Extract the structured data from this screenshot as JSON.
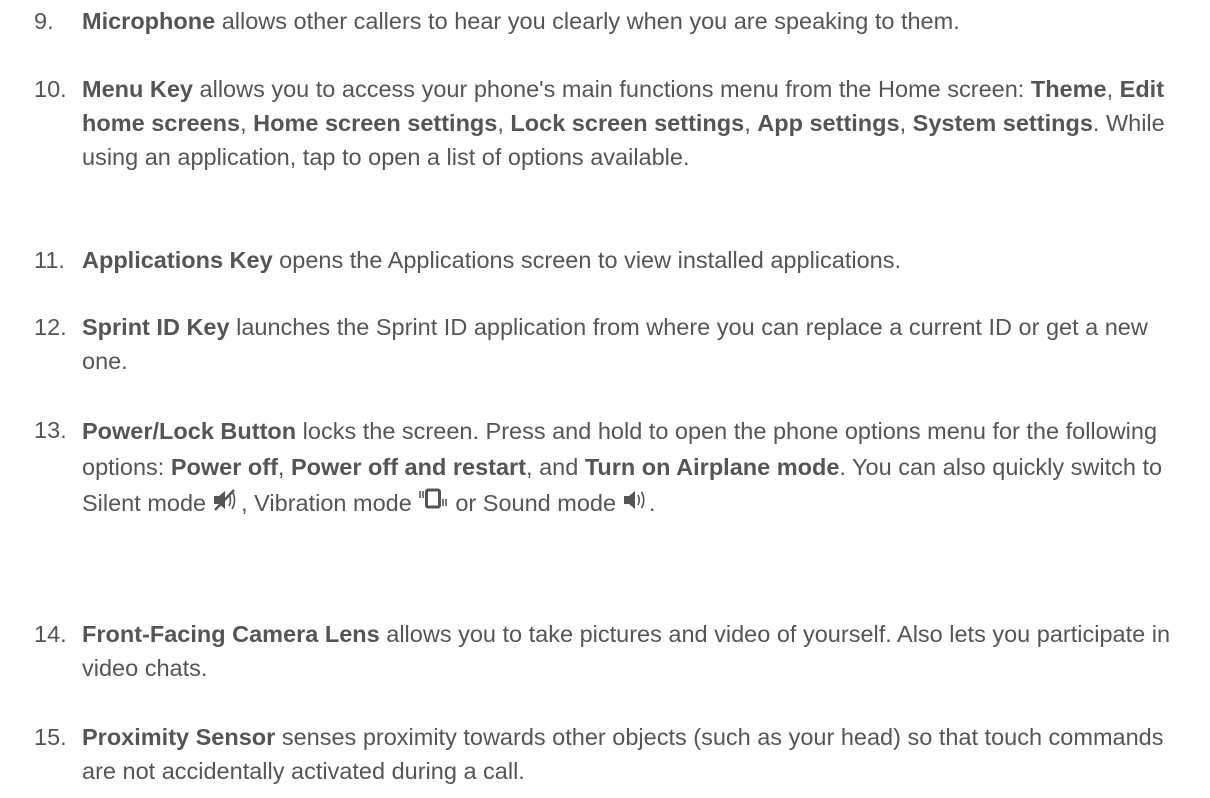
{
  "items": [
    {
      "number": "9.",
      "parts": [
        {
          "b": true,
          "t": "Microphone"
        },
        {
          "b": false,
          "t": " allows other callers to hear you clearly when you are speaking to them."
        }
      ]
    },
    {
      "number": "10.",
      "parts": [
        {
          "b": true,
          "t": "Menu Key"
        },
        {
          "b": false,
          "t": " allows you to access your phone's main functions menu from the Home screen: "
        },
        {
          "b": true,
          "t": "Theme"
        },
        {
          "b": false,
          "t": ", "
        },
        {
          "b": true,
          "t": "Edit home screens"
        },
        {
          "b": false,
          "t": ", "
        },
        {
          "b": true,
          "t": "Home screen settings"
        },
        {
          "b": false,
          "t": ", "
        },
        {
          "b": true,
          "t": "Lock screen settings"
        },
        {
          "b": false,
          "t": ", "
        },
        {
          "b": true,
          "t": "App settings"
        },
        {
          "b": false,
          "t": ", "
        },
        {
          "b": true,
          "t": "System settings"
        },
        {
          "b": false,
          "t": ". While using an application, tap to open a list of options available."
        }
      ]
    },
    {
      "number": "11.",
      "parts": [
        {
          "b": true,
          "t": "Applications Key"
        },
        {
          "b": false,
          "t": " opens the Applications screen to view installed applications."
        }
      ]
    },
    {
      "number": "12.",
      "parts": [
        {
          "b": true,
          "t": "Sprint ID Key"
        },
        {
          "b": false,
          "t": " launches the Sprint ID application from where you can replace a current ID or get a new one."
        }
      ]
    },
    {
      "number": "13.",
      "parts": [
        {
          "b": true,
          "t": "Power/Lock Button"
        },
        {
          "b": false,
          "t": " locks the screen. Press and hold to open the phone options menu for the following options: "
        },
        {
          "b": true,
          "t": "Power off"
        },
        {
          "b": false,
          "t": ", "
        },
        {
          "b": true,
          "t": "Power off and restart"
        },
        {
          "b": false,
          "t": ", and "
        },
        {
          "b": true,
          "t": "Turn on Airplane mode"
        },
        {
          "b": false,
          "t": ". You can also quickly switch to Silent mode"
        },
        {
          "icon": "silent-mode-icon"
        },
        {
          "b": false,
          "t": ", Vibration mode"
        },
        {
          "icon": "vibration-mode-icon"
        },
        {
          "b": false,
          "t": " or Sound mode"
        },
        {
          "icon": "sound-mode-icon"
        },
        {
          "b": false,
          "t": "."
        }
      ]
    },
    {
      "number": "14.",
      "parts": [
        {
          "b": true,
          "t": "Front-Facing Camera Lens"
        },
        {
          "b": false,
          "t": " allows you to take pictures and video of yourself. Also lets you participate in video chats."
        }
      ]
    },
    {
      "number": "15.",
      "parts": [
        {
          "b": true,
          "t": "Proximity Sensor"
        },
        {
          "b": false,
          "t": " senses proximity towards other objects (such as your head) so that touch commands are not accidentally activated during a call."
        }
      ]
    }
  ],
  "colors": {
    "text": "#555555",
    "icon": "#555555"
  }
}
